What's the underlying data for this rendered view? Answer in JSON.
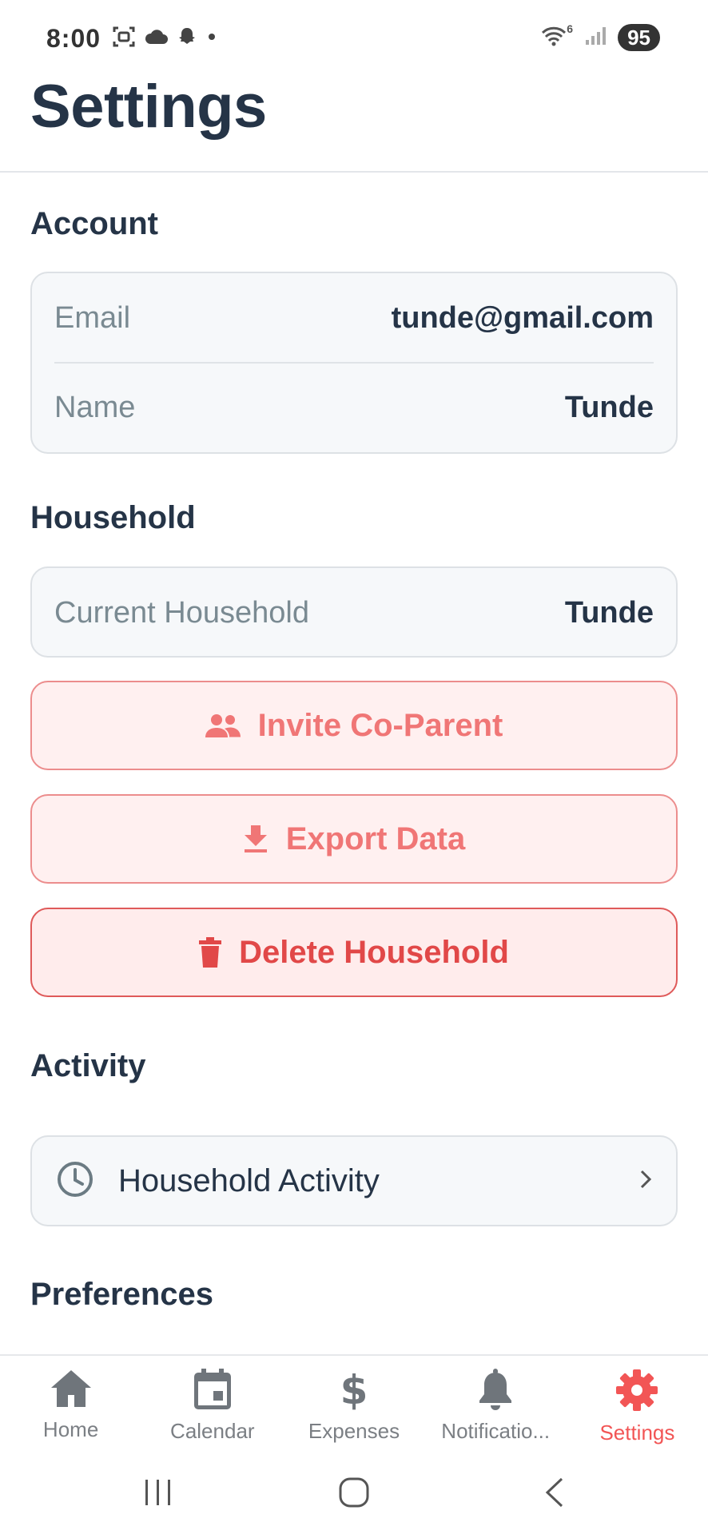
{
  "status_bar": {
    "time": "8:00",
    "wifi_badge": "6",
    "battery": "95",
    "icons": [
      "screenshot-icon",
      "cloud-icon",
      "snapchat-icon",
      "dot-icon"
    ]
  },
  "header": {
    "title": "Settings"
  },
  "account": {
    "section_title": "Account",
    "email_label": "Email",
    "email_value": "tunde@gmail.com",
    "name_label": "Name",
    "name_value": "Tunde"
  },
  "household": {
    "section_title": "Household",
    "current_label": "Current Household",
    "current_value": "Tunde",
    "invite_label": "Invite Co-Parent",
    "export_label": "Export Data",
    "delete_label": "Delete Household"
  },
  "activity": {
    "section_title": "Activity",
    "item_label": "Household Activity"
  },
  "preferences": {
    "section_title": "Preferences"
  },
  "bottom_nav": {
    "items": [
      {
        "label": "Home",
        "icon": "home-icon"
      },
      {
        "label": "Calendar",
        "icon": "calendar-icon"
      },
      {
        "label": "Expenses",
        "icon": "dollar-icon"
      },
      {
        "label": "Notificatio...",
        "icon": "bell-icon"
      },
      {
        "label": "Settings",
        "icon": "gear-icon",
        "active": true
      }
    ]
  },
  "colors": {
    "text_dark": "#253447",
    "text_muted": "#7a8a92",
    "accent": "#f25555",
    "danger": "#e14848",
    "card_bg": "#f6f8fa"
  }
}
